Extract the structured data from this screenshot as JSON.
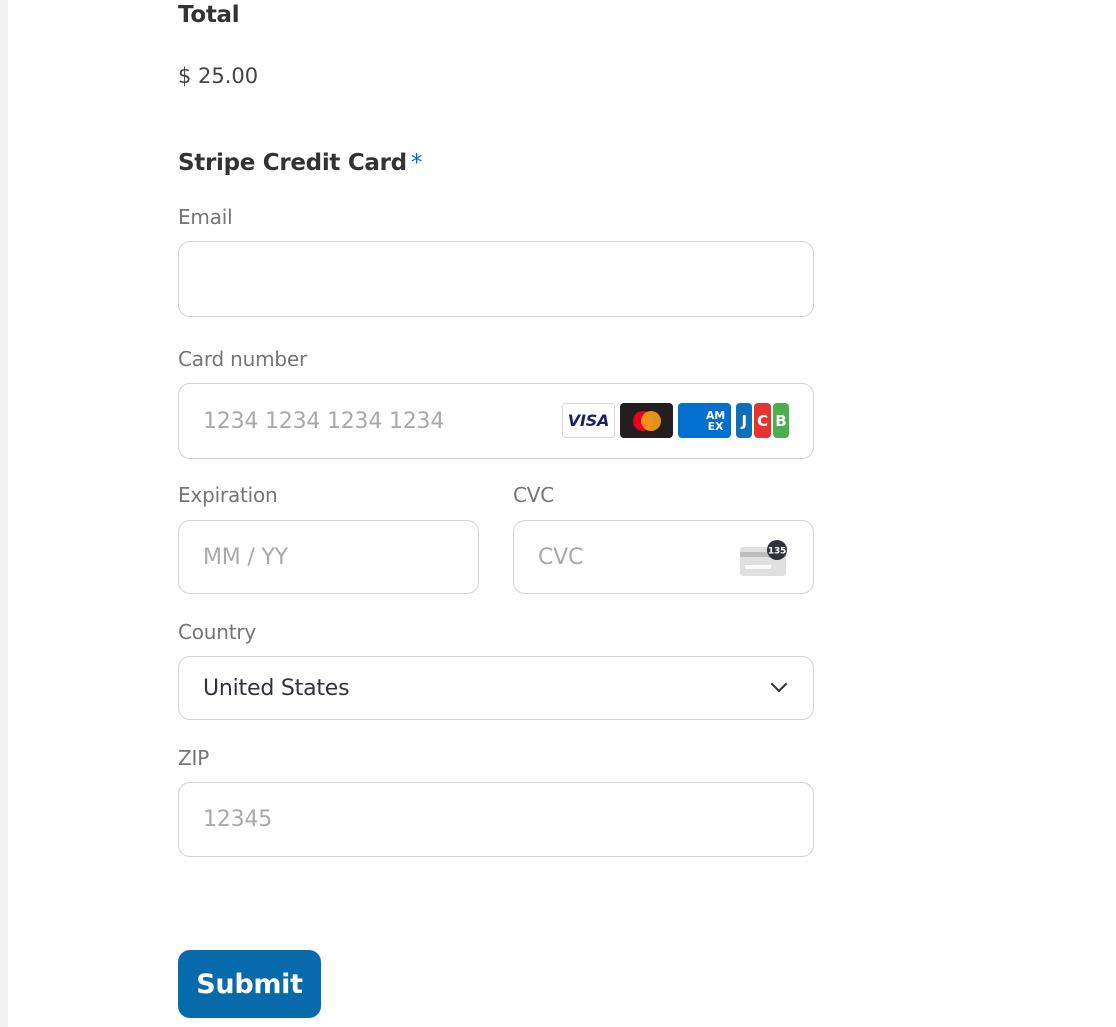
{
  "total": {
    "label": "Total",
    "value": "$ 25.00"
  },
  "payment": {
    "title": "Stripe Credit Card",
    "required_mark": "*",
    "email": {
      "label": "Email",
      "value": "",
      "placeholder": ""
    },
    "card_number": {
      "label": "Card number",
      "placeholder": "1234 1234 1234 1234",
      "brands": [
        {
          "name": "visa",
          "label": "VISA"
        },
        {
          "name": "mastercard",
          "label": ""
        },
        {
          "name": "amex",
          "label": "AM EX"
        },
        {
          "name": "jcb",
          "label": "JCB"
        }
      ]
    },
    "expiration": {
      "label": "Expiration",
      "placeholder": "MM / YY"
    },
    "cvc": {
      "label": "CVC",
      "placeholder": "CVC",
      "icon_badge": "135"
    },
    "country": {
      "label": "Country",
      "selected": "United States"
    },
    "zip": {
      "label": "ZIP",
      "placeholder": "12345"
    }
  },
  "submit_label": "Submit",
  "colors": {
    "accent": "#066aab",
    "label": "#757575",
    "border": "#d3d3d3",
    "heading": "#333333"
  }
}
